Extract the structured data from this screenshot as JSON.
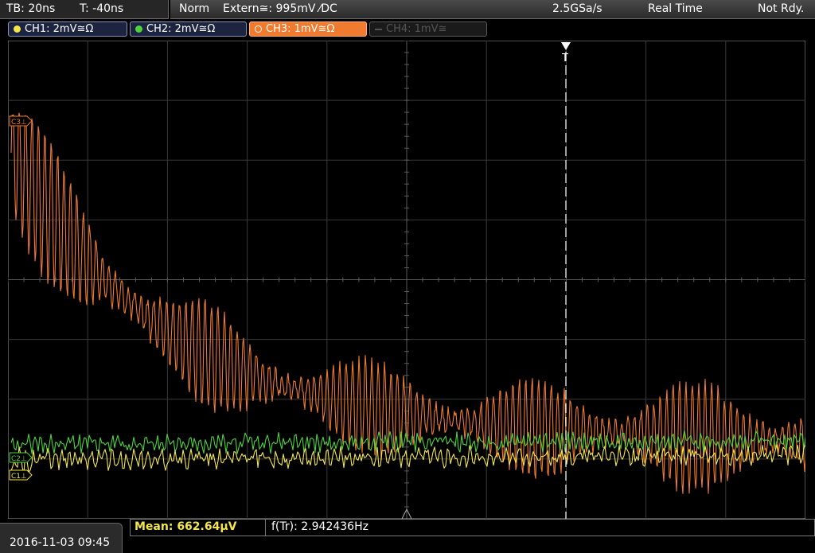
{
  "topbar": {
    "timebase": "TB: 20ns",
    "trigger_time": "T: -40ns",
    "mode": "Norm",
    "trigger_source": "Extern≅: 995mV ⁄DC",
    "sample_rate": "2.5GSa/s",
    "acquisition": "Real Time",
    "state": "Not Rdy."
  },
  "channels": [
    {
      "label": "CH1: 2mV≅Ω",
      "color": "#f2e64a"
    },
    {
      "label": "CH2: 2mV≅Ω",
      "color": "#4cd43c"
    },
    {
      "label": "CH3: 1mV≅Ω",
      "color": "#f07a2e"
    },
    {
      "label": "CH4: 1mV≅",
      "color": "#555555"
    }
  ],
  "markers": {
    "ch3": "C3⊥",
    "ch2": "C2⊥",
    "ch1": "C1⊥",
    "trigger": "T"
  },
  "measurements": {
    "mean": "Mean: 662.64µV",
    "frequency": "f(Tr): 2.942436Hz"
  },
  "footer": {
    "datetime": "2016-11-03 09:45"
  },
  "colors": {
    "ch1": "#f2e64a",
    "ch2": "#4cd43c",
    "ch3": "#f07a2e",
    "grid": "#3a3a3a",
    "trigger_marker": "#ffffff"
  }
}
